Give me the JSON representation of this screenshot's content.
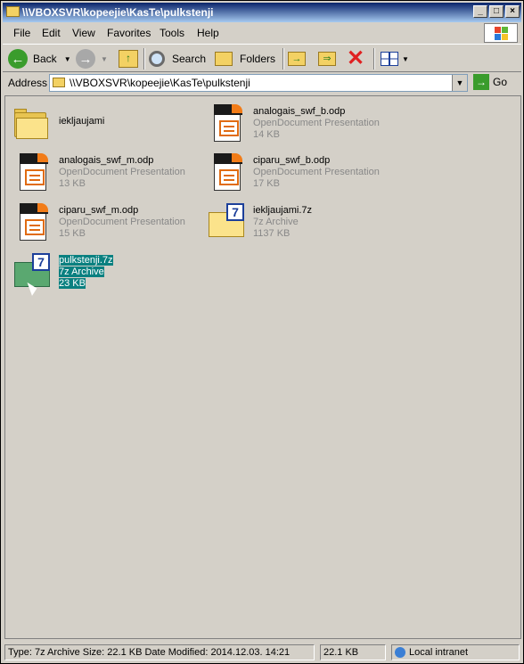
{
  "window": {
    "title": "\\\\VBOXSVR\\kopeejie\\KasTe\\pulkstenji"
  },
  "menu": [
    "File",
    "Edit",
    "View",
    "Favorites",
    "Tools",
    "Help"
  ],
  "toolbar": {
    "back": "Back",
    "search": "Search",
    "folders": "Folders"
  },
  "address": {
    "label": "Address",
    "path": "\\\\VBOXSVR\\kopeejie\\KasTe\\pulkstenji",
    "go": "Go"
  },
  "files": [
    {
      "name": "iekljaujami",
      "type": "",
      "size": ""
    },
    {
      "name": "analogais_swf_b.odp",
      "type": "OpenDocument Presentation",
      "size": "14 KB"
    },
    {
      "name": "analogais_swf_m.odp",
      "type": "OpenDocument Presentation",
      "size": "13 KB"
    },
    {
      "name": "ciparu_swf_b.odp",
      "type": "OpenDocument Presentation",
      "size": "17 KB"
    },
    {
      "name": "ciparu_swf_m.odp",
      "type": "OpenDocument Presentation",
      "size": "15 KB"
    },
    {
      "name": "iekljaujami.7z",
      "type": "7z Archive",
      "size": "1137 KB"
    },
    {
      "name": "pulkstenji.7z",
      "type": "7z Archive",
      "size": "23 KB"
    }
  ],
  "status": {
    "details": "Type: 7z Archive Size: 22.1 KB Date Modified: 2014.12.03. 14:21",
    "size": "22.1 KB",
    "zone": "Local intranet"
  },
  "colors": {
    "title_start": "#0a246a",
    "title_end": "#a6caf0",
    "selection": "#0a8080"
  }
}
